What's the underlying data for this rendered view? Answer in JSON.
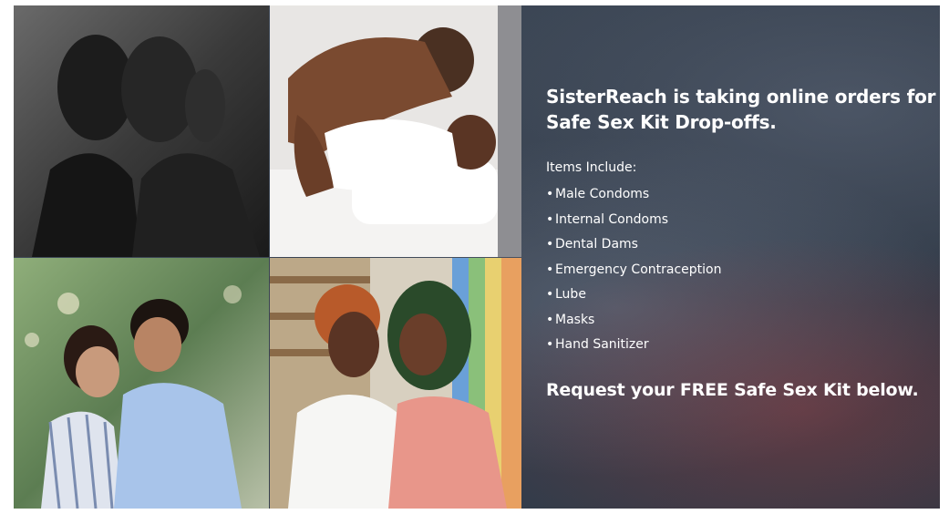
{
  "banner": {
    "headline": "SisterReach is taking online orders for Safe Sex Kit Drop-offs.",
    "items_title": "Items Include:",
    "bullet": "•",
    "items": [
      "Male Condoms",
      "Internal Condoms",
      "Dental Dams",
      "Emergency Contraception",
      "Lube",
      "Masks",
      "Hand Sanitizer"
    ],
    "cta": "Request your FREE Safe Sex Kit below."
  },
  "photos": [
    {
      "name": "couple-photo-1"
    },
    {
      "name": "couple-photo-2"
    },
    {
      "name": "couple-photo-3"
    },
    {
      "name": "couple-photo-4"
    }
  ],
  "colors": {
    "text": "#ffffff",
    "background": "#3b4656"
  }
}
